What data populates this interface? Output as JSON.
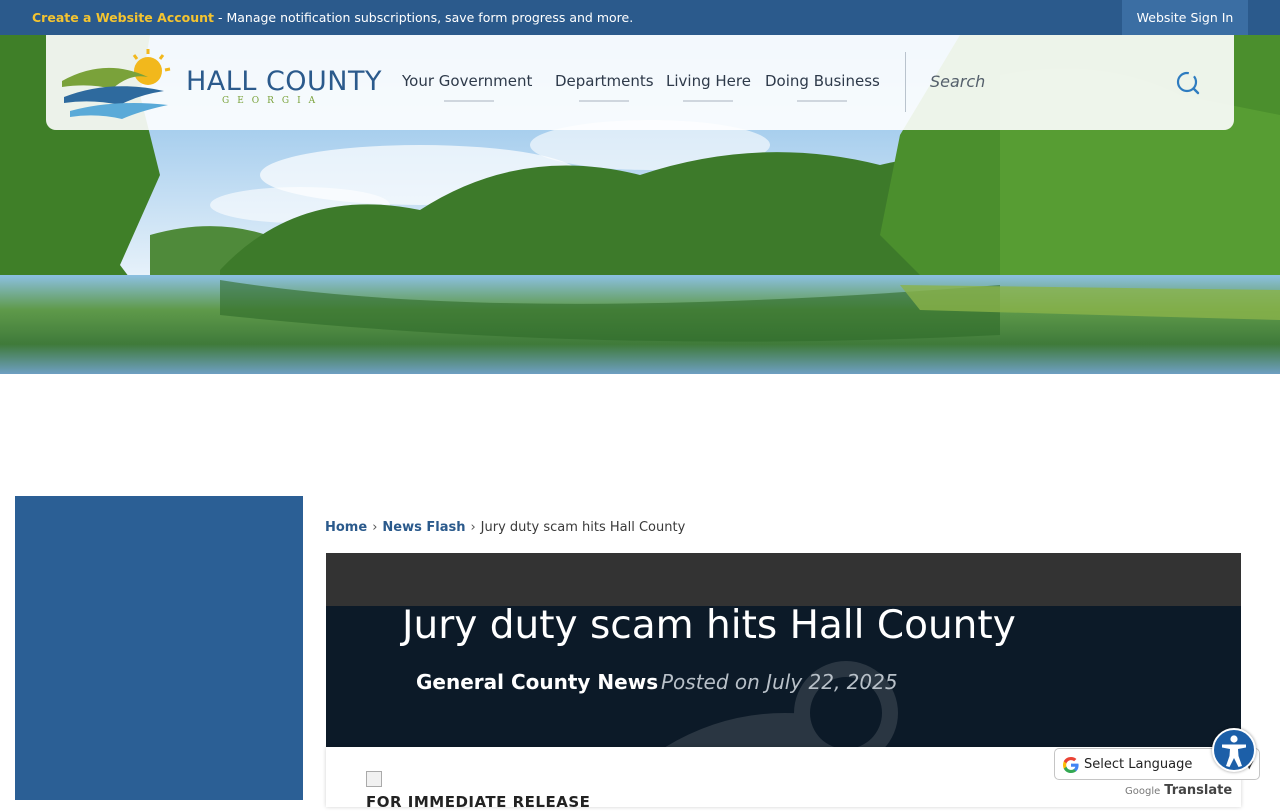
{
  "topbar": {
    "create_account_link": "Create a Website Account",
    "message": " - Manage notification subscriptions, save form progress and more.",
    "sign_in_label": "Website Sign In"
  },
  "header": {
    "logo_title": "HALL COUNTY",
    "logo_subtitle": "GEORGIA",
    "nav": [
      {
        "label": "Your Government"
      },
      {
        "label": "Departments"
      },
      {
        "label": "Living Here"
      },
      {
        "label": "Doing Business"
      }
    ],
    "search_placeholder": "Search",
    "search_icon": "search-icon"
  },
  "breadcrumb": {
    "home": "Home",
    "separator": "›",
    "news_flash": "News Flash",
    "current": "Jury duty scam hits Hall County"
  },
  "article": {
    "title": "Jury duty scam hits Hall County",
    "category": "General County News",
    "posted": "Posted on July 22, 2025",
    "release_heading": "FOR IMMEDIATE RELEASE"
  },
  "translate": {
    "select_label": "Select Language",
    "powered_google": "Google",
    "powered_translate": "Translate"
  },
  "colors": {
    "topbar_bg": "#2b5a8c",
    "accent_yellow": "#f4c430",
    "sidebar_bg": "#2b5f95",
    "banner_bg": "#0c1a28",
    "logo_green": "#7aa23a"
  }
}
